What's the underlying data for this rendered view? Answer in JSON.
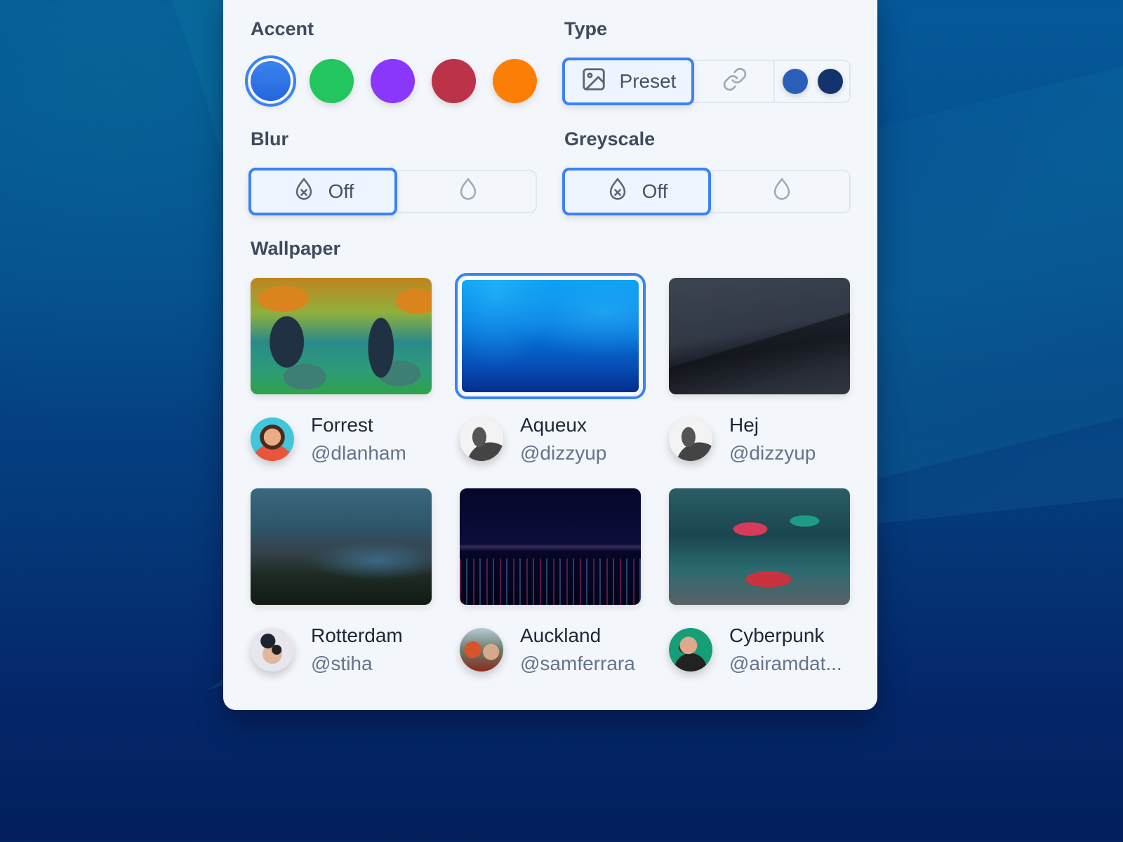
{
  "accent": {
    "label": "Accent",
    "colors": [
      {
        "name": "blue",
        "hex": "#2f76e8",
        "selected": true
      },
      {
        "name": "green",
        "hex": "#22c55e",
        "selected": false
      },
      {
        "name": "purple",
        "hex": "#8b36fb",
        "selected": false
      },
      {
        "name": "red",
        "hex": "#bb3249",
        "selected": false
      },
      {
        "name": "orange",
        "hex": "#fd7e07",
        "selected": false
      }
    ]
  },
  "type": {
    "label": "Type",
    "options": [
      {
        "id": "preset",
        "label": "Preset",
        "icon": "image-icon",
        "selected": true
      },
      {
        "id": "url",
        "label": "",
        "icon": "link-icon",
        "selected": false
      },
      {
        "id": "gradient",
        "label": "",
        "icon": "gradient-colors",
        "selected": false
      }
    ],
    "gradient_colors": [
      "#2a5fb9",
      "#13336e"
    ]
  },
  "blur": {
    "label": "Blur",
    "options": [
      {
        "id": "off",
        "label": "Off",
        "icon": "droplet-off-icon",
        "selected": true
      },
      {
        "id": "on",
        "label": "",
        "icon": "droplet-icon",
        "selected": false
      }
    ]
  },
  "greyscale": {
    "label": "Greyscale",
    "options": [
      {
        "id": "off",
        "label": "Off",
        "icon": "droplet-off-icon",
        "selected": true
      },
      {
        "id": "on",
        "label": "",
        "icon": "droplet-icon",
        "selected": false
      }
    ]
  },
  "wallpaper": {
    "label": "Wallpaper",
    "items": [
      {
        "title": "Forrest",
        "author": "@dlanham",
        "selected": false
      },
      {
        "title": "Aqueux",
        "author": "@dizzyup",
        "selected": true
      },
      {
        "title": "Hej",
        "author": "@dizzyup",
        "selected": false
      },
      {
        "title": "Rotterdam",
        "author": "@stiha",
        "selected": false
      },
      {
        "title": "Auckland",
        "author": "@samferrara",
        "selected": false
      },
      {
        "title": "Cyberpunk",
        "author": "@airamdat...",
        "selected": false
      }
    ]
  },
  "colors": {
    "selection": "#3b82f6",
    "panel_bg": "#f3f6fa",
    "label_text": "#3f4b5e",
    "handle_text": "#64748b"
  }
}
